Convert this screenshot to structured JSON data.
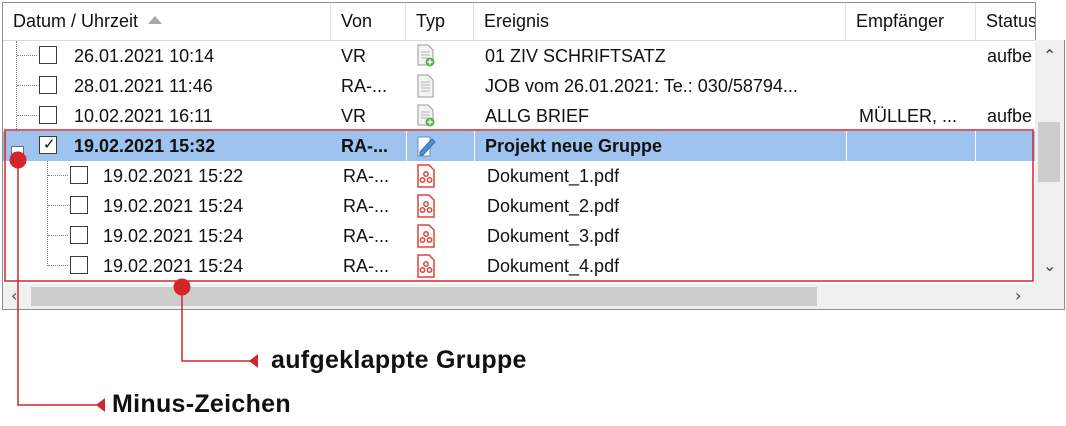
{
  "columns": [
    {
      "label": "Datum / Uhrzeit"
    },
    {
      "label": "Von"
    },
    {
      "label": "Typ"
    },
    {
      "label": "Ereignis"
    },
    {
      "label": "Empfänger"
    },
    {
      "label": "Status"
    }
  ],
  "rows": [
    {
      "date": "26.01.2021  10:14",
      "von": "VR",
      "typ": "document-new-icon",
      "ereignis": "01 ZIV SCHRIFTSATZ",
      "empfaenger": "",
      "status": "aufbe",
      "checked": false
    },
    {
      "date": "28.01.2021  11:46",
      "von": "RA-...",
      "typ": "document-icon",
      "ereignis": "JOB vom 26.01.2021: Te.: 030/58794...",
      "empfaenger": "",
      "status": "",
      "checked": false
    },
    {
      "date": "10.02.2021  16:11",
      "von": "VR",
      "typ": "document-new-icon",
      "ereignis": "ALLG BRIEF",
      "empfaenger": "MÜLLER, ...",
      "status": "aufbe",
      "checked": false
    },
    {
      "date": "19.02.2021  15:32",
      "von": "RA-...",
      "typ": "edit-document-icon",
      "ereignis": "Projekt neue Gruppe",
      "empfaenger": "",
      "status": "",
      "checked": true,
      "selected": true
    },
    {
      "date": "19.02.2021  15:22",
      "von": "RA-...",
      "typ": "pdf-icon",
      "ereignis": "Dokument_1.pdf",
      "empfaenger": "",
      "status": "",
      "checked": false,
      "child": true
    },
    {
      "date": "19.02.2021  15:24",
      "von": "RA-...",
      "typ": "pdf-icon",
      "ereignis": "Dokument_2.pdf",
      "empfaenger": "",
      "status": "",
      "checked": false,
      "child": true
    },
    {
      "date": "19.02.2021  15:24",
      "von": "RA-...",
      "typ": "pdf-icon",
      "ereignis": "Dokument_3.pdf",
      "empfaenger": "",
      "status": "",
      "checked": false,
      "child": true
    },
    {
      "date": "19.02.2021  15:24",
      "von": "RA-...",
      "typ": "pdf-icon",
      "ereignis": "Dokument_4.pdf",
      "empfaenger": "",
      "status": "",
      "checked": false,
      "child": true
    }
  ],
  "annotations": {
    "group_label": "aufgeklappte Gruppe",
    "minus_label": "Minus-Zeichen"
  },
  "colors": {
    "selection": "#9dc3ee",
    "annotation_red": "#d4252b",
    "pdf_red": "#e0443a"
  }
}
